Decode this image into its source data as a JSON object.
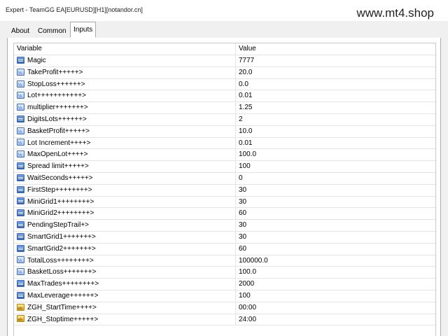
{
  "window": {
    "title": "Expert - TeamGG EA[EURUSD][H1][notandor.cn]",
    "watermark": "www.mt4.shop"
  },
  "tabs": [
    {
      "label": "About",
      "active": false
    },
    {
      "label": "Common",
      "active": false
    },
    {
      "label": "Inputs",
      "active": true
    }
  ],
  "table": {
    "headers": {
      "variable": "Variable",
      "value": "Value"
    },
    "rows": [
      {
        "variable": "Magic",
        "value": "7777",
        "icon": "int-type-icon"
      },
      {
        "variable": "TakeProfit+++++>",
        "value": "20.0",
        "icon": "double-type-icon"
      },
      {
        "variable": "StopLoss++++++>",
        "value": "0.0",
        "icon": "double-type-icon"
      },
      {
        "variable": "Lot+++++++++++>",
        "value": "0.01",
        "icon": "double-type-icon"
      },
      {
        "variable": "multiplier+++++++>",
        "value": "1.25",
        "icon": "double-type-icon"
      },
      {
        "variable": "DigitsLots++++++>",
        "value": "2",
        "icon": "int-type-icon"
      },
      {
        "variable": "BasketProfit+++++>",
        "value": "10.0",
        "icon": "double-type-icon"
      },
      {
        "variable": "Lot Increment++++>",
        "value": "0.01",
        "icon": "double-type-icon"
      },
      {
        "variable": "MaxOpenLot++++>",
        "value": "100.0",
        "icon": "double-type-icon"
      },
      {
        "variable": "Spread limit+++++>",
        "value": "100",
        "icon": "int-type-icon"
      },
      {
        "variable": "WaitSeconds+++++>",
        "value": "0",
        "icon": "int-type-icon"
      },
      {
        "variable": "FirstStep++++++++>",
        "value": "30",
        "icon": "int-type-icon"
      },
      {
        "variable": "MiniGrid1++++++++>",
        "value": "30",
        "icon": "int-type-icon"
      },
      {
        "variable": "MiniGrid2++++++++>",
        "value": "60",
        "icon": "int-type-icon"
      },
      {
        "variable": "PendingStepTrail+>",
        "value": "30",
        "icon": "int-type-icon"
      },
      {
        "variable": "SmartGrid1+++++++>",
        "value": "30",
        "icon": "int-type-icon"
      },
      {
        "variable": "SmartGrid2+++++++>",
        "value": "60",
        "icon": "int-type-icon"
      },
      {
        "variable": "TotalLoss++++++++>",
        "value": "100000.0",
        "icon": "double-type-icon"
      },
      {
        "variable": "BasketLoss+++++++>",
        "value": "100.0",
        "icon": "double-type-icon"
      },
      {
        "variable": "MaxTrades++++++++>",
        "value": "2000",
        "icon": "int-type-icon"
      },
      {
        "variable": "MaxLeverage++++++>",
        "value": "100",
        "icon": "int-type-icon"
      },
      {
        "variable": "ZGH_StartTime++++>",
        "value": "00:00",
        "icon": "string-type-icon"
      },
      {
        "variable": "ZGH_Stoptime+++++>",
        "value": "24:00",
        "icon": "string-type-icon"
      }
    ]
  }
}
